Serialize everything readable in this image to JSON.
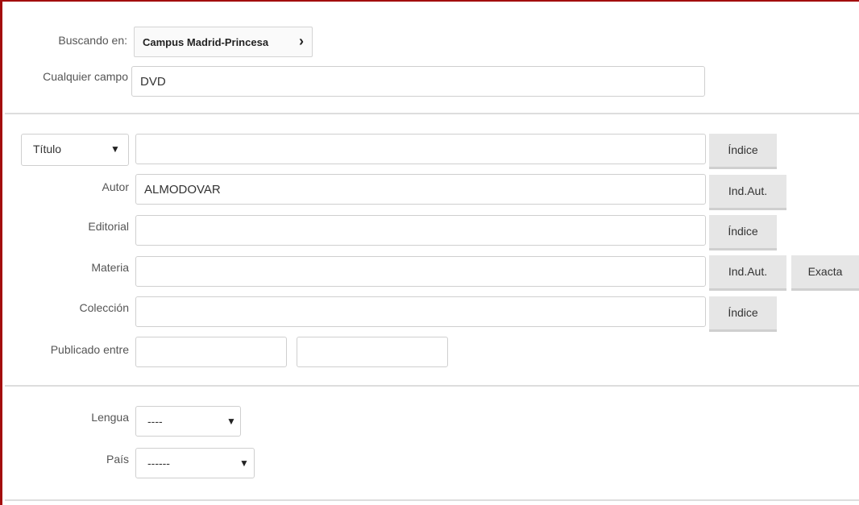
{
  "header": {
    "searching_in_label": "Buscando en:",
    "location_value": "Campus Madrid-Princesa",
    "location_chevron": "›"
  },
  "any_field": {
    "label": "Cualquier campo",
    "value": "DVD"
  },
  "title_row": {
    "select_value": "Título",
    "value": "",
    "button": "Índice"
  },
  "author_row": {
    "label": "Autor",
    "value": "ALMODOVAR",
    "button": "Ind.Aut."
  },
  "publisher_row": {
    "label": "Editorial",
    "value": "",
    "button": "Índice"
  },
  "subject_row": {
    "label": "Materia",
    "value": "",
    "button": "Ind.Aut.",
    "button2": "Exacta"
  },
  "collection_row": {
    "label": "Colección",
    "value": "",
    "button": "Índice"
  },
  "published_row": {
    "label": "Publicado entre",
    "from": "",
    "to": ""
  },
  "language_row": {
    "label": "Lengua",
    "select_value": "----"
  },
  "country_row": {
    "label": "País",
    "select_value": "------"
  },
  "colors": {
    "accent_border": "#a30d0d",
    "button_bg": "#e6e6e6"
  }
}
